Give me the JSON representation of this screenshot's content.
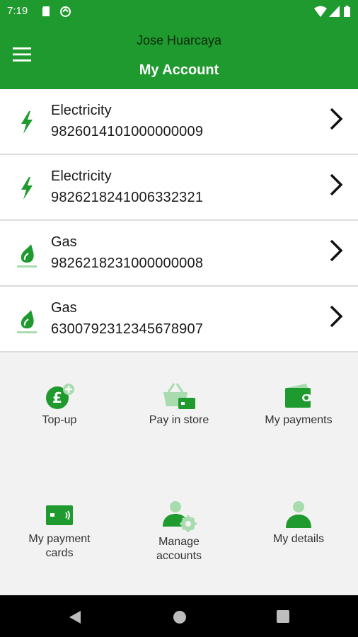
{
  "status_bar": {
    "time": "7:19"
  },
  "header": {
    "user_name": "Jose Huarcaya",
    "title": "My Account"
  },
  "accounts": [
    {
      "type": "Electricity",
      "number": "9826014101000000009",
      "icon": "lightning-icon"
    },
    {
      "type": "Electricity",
      "number": "9826218241006332321",
      "icon": "lightning-icon"
    },
    {
      "type": "Gas",
      "number": "9826218231000000008",
      "icon": "gas-flame-icon"
    },
    {
      "type": "Gas",
      "number": "6300792312345678907",
      "icon": "gas-flame-icon"
    }
  ],
  "actions": [
    {
      "label": "Top-up",
      "icon": "top-up-pound-icon"
    },
    {
      "label": "Pay in store",
      "icon": "basket-card-icon"
    },
    {
      "label": "My payments",
      "icon": "wallet-icon"
    },
    {
      "label": "My payment\ncards",
      "icon": "payment-card-icon"
    },
    {
      "label": "Manage\naccounts",
      "icon": "user-gear-icon"
    },
    {
      "label": "My details",
      "icon": "user-icon"
    }
  ],
  "colors": {
    "brand_green": "#1f9a2f",
    "icon_green": "#1f9a2f",
    "icon_light_green": "#a8dcae",
    "background": "#f2f2f2"
  }
}
